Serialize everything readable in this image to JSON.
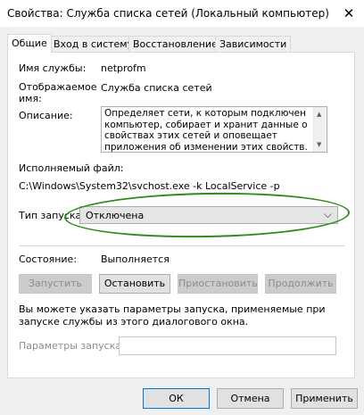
{
  "window": {
    "title": "Свойства: Служба списка сетей (Локальный компьютер)",
    "close_glyph": "✕"
  },
  "tabs": [
    {
      "label": "Общие",
      "active": true
    },
    {
      "label": "Вход в систему",
      "active": false
    },
    {
      "label": "Восстановление",
      "active": false
    },
    {
      "label": "Зависимости",
      "active": false
    }
  ],
  "general": {
    "service_name_label": "Имя службы:",
    "service_name_value": "netprofm",
    "display_name_label": "Отображаемое\nимя:",
    "display_name_value": "Служба списка сетей",
    "description_label": "Описание:",
    "description_value": "Определяет сети, к которым подключен компьютер, собирает и хранит данные о свойствах этих сетей и оповещает приложения об изменении этих свойств.",
    "exe_label": "Исполняемый файл:",
    "exe_value": "C:\\Windows\\System32\\svchost.exe -k LocalService -p",
    "startup_label": "Тип запуска:",
    "startup_value": "Отключена",
    "status_label": "Состояние:",
    "status_value": "Выполняется",
    "buttons": {
      "start": "Запустить",
      "stop": "Остановить",
      "pause": "Приостановить",
      "resume": "Продолжить"
    },
    "hint": "Вы можете указать параметры запуска, применяемые при запуске службы из этого диалогового окна.",
    "params_label": "Параметры запуска:",
    "params_value": ""
  },
  "footer": {
    "ok": "ОК",
    "cancel": "Отмена",
    "apply": "Применить"
  },
  "colors": {
    "annotation_circle": "#2e8b1a",
    "focus_border": "#0078d7"
  }
}
